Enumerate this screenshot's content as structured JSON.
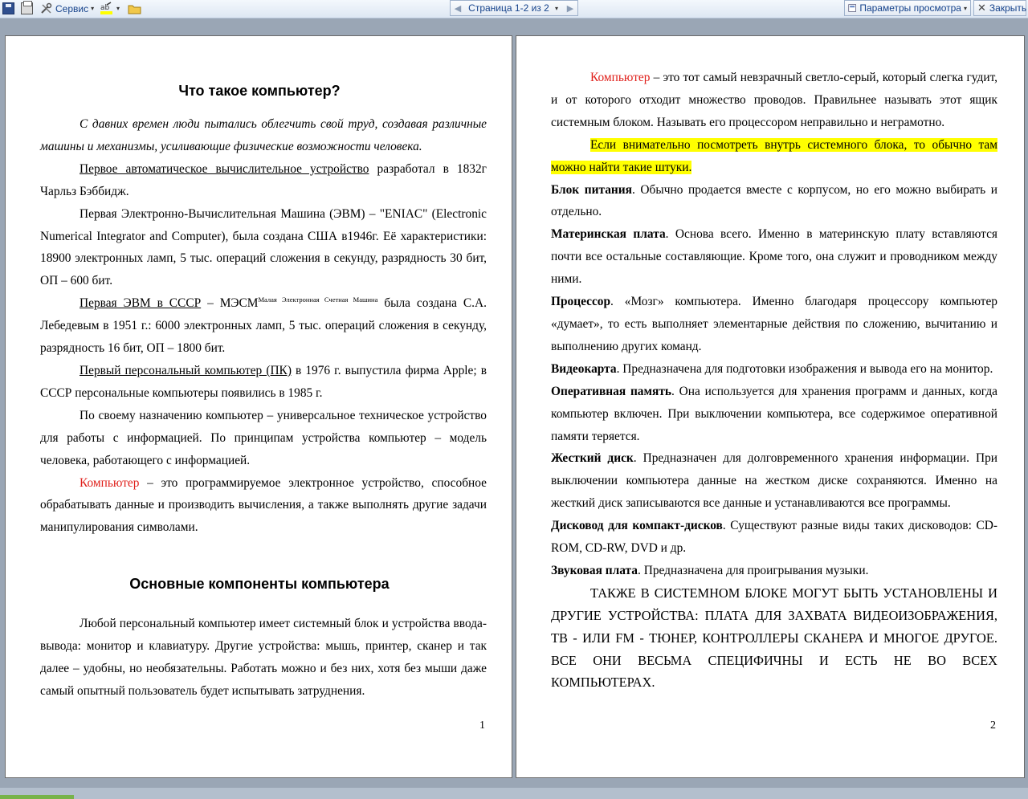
{
  "toolbar": {
    "service_label": "Сервис",
    "pager_label": "Страница 1-2 из 2",
    "view_options_label": "Параметры просмотра",
    "close_label": "Закрыть"
  },
  "page1": {
    "title": "Что такое компьютер?",
    "p1": "С давних времен люди пытались облегчить свой труд, создавая различные машины и механизмы, усиливающие физические возможности человека.",
    "p2_u": "Первое автоматическое вычислительное устройство",
    "p2_rest": " разработал в 1832г Чарльз Бэббидж.",
    "p3": "Первая Электронно-Вычислительная Машина (ЭВМ) – \"ENIAC\" (Electronic Numerical Integrator and Computer), была создана США в1946г. Её характеристики: 18900 электронных ламп, 5 тыс. операций сложения в секунду, разрядность 30 бит, ОП – 600 бит.",
    "p4_u": "Первая ЭВМ в СССР",
    "p4_a": " – МЭСМ",
    "p4_sup": "Малая Электронная Счетная Машина",
    "p4_b": " была создана С.А. Лебедевым в 1951 г.: 6000 электронных ламп, 5 тыс. операций сложения в секунду, разрядность 16 бит, ОП – 1800 бит.",
    "p5_u": "Первый персональный компьютер (ПК)",
    "p5_rest": " в 1976 г. выпустила фирма Apple; в СССР персональные компьютеры появились в 1985 г.",
    "p6": "По своему назначению компьютер – универсальное техническое устройство для работы с информацией. По принципам устройства компьютер – модель человека, работающего с информацией.",
    "p7_red": "Компьютер",
    "p7_rest": " – это программируемое электронное устройство, способное обрабатывать данные и производить вычисления, а также выполнять другие задачи манипулирования символами.",
    "heading2": "Основные компоненты компьютера",
    "p8": "Любой персональный компьютер имеет системный блок и устройства ввода-вывода: монитор и клавиатуру. Другие устройства: мышь, принтер, сканер и так далее – удобны, но необязательны. Работать можно и без них, хотя без мыши даже самый опытный пользователь будет испытывать затруднения.",
    "page_number": "1"
  },
  "page2": {
    "p1_red": "Компьютер",
    "p1_rest": " – это тот самый невзрачный светло-серый, который слегка гудит, и от которого отходит множество проводов. Правильнее называть этот ящик системным блоком. Называть его процессором неправильно и неграмотно.",
    "p2_highlight": "Если внимательно посмотреть внутрь системного блока, то обычно там можно найти такие штуки.",
    "items": [
      {
        "term": "Блок питания",
        "text": ". Обычно продается вместе с корпусом, но его можно выбирать и отдельно."
      },
      {
        "term": "Материнская плата",
        "text": ". Основа всего. Именно в материнскую плату вставляются почти все остальные составляющие. Кроме того, она служит и проводником между ними."
      },
      {
        "term": "Процессор",
        "text": ". «Мозг» компьютера. Именно благодаря процессору компьютер «думает», то есть выполняет элементарные действия по сложению, вычитанию и выполнению других команд."
      },
      {
        "term": "Видеокарта",
        "text": ". Предназначена для подготовки изображения и вывода его на монитор."
      },
      {
        "term": "Оперативная память",
        "text": ". Она используется для хранения программ и данных, когда компьютер включен. При выключении компьютера, все содержимое оперативной памяти теряется."
      },
      {
        "term": "Жесткий диск",
        "text": ". Предназначен для долговременного хранения информации. При выключении компьютера данные на жестком диске сохраняются. Именно на жесткий диск записываются все данные и устанавливаются все программы."
      },
      {
        "term": "Дисковод для компакт-дисков",
        "text": ". Существуют разные виды таких дисководов: CD-ROM, CD-RW, DVD и др."
      },
      {
        "term": "Звуковая плата",
        "text": ". Предназначена для проигрывания музыки."
      }
    ],
    "p_caps": "ТАКЖЕ В СИСТЕМНОМ БЛОКЕ МОГУТ БЫТЬ УСТАНОВЛЕНЫ И ДРУГИЕ УСТРОЙСТВА: ПЛАТА ДЛЯ ЗАХВАТА ВИДЕОИЗОБРАЖЕНИЯ, ТВ - ИЛИ FM - ТЮНЕР, КОНТРОЛЛЕРЫ СКАНЕРА И МНОГОЕ ДРУГОЕ. ВСЕ ОНИ ВЕСЬМА СПЕЦИФИЧНЫ И ЕСТЬ НЕ ВО ВСЕХ КОМПЬЮТЕРАХ.",
    "page_number": "2"
  },
  "colors": {
    "accent_red": "#e0201b",
    "highlight": "#ffff00"
  },
  "icons": [
    "save-icon",
    "print-icon",
    "service-tools-icon",
    "highlight-icon",
    "folder-icon",
    "prev-page-icon",
    "next-page-icon",
    "view-options-icon",
    "close-icon"
  ]
}
